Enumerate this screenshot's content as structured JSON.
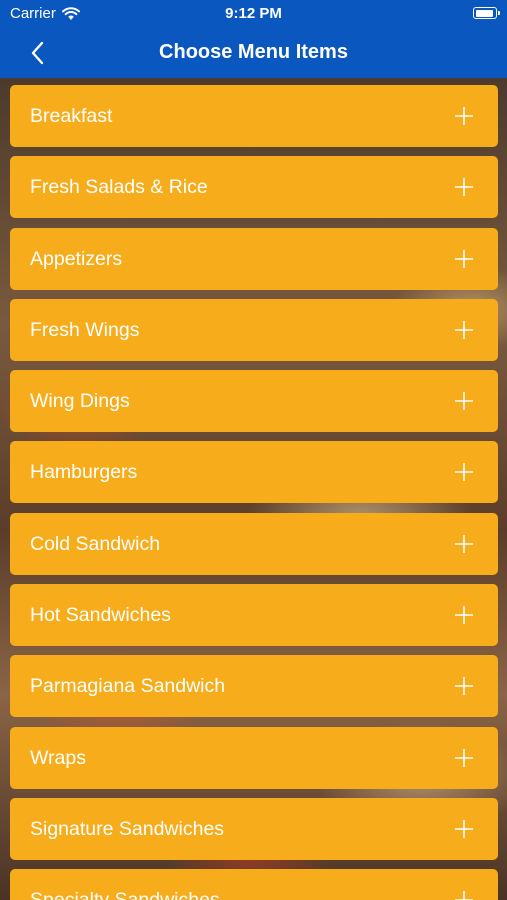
{
  "status_bar": {
    "carrier": "Carrier",
    "time": "9:12 PM",
    "battery_level": 0.95
  },
  "nav": {
    "back_icon": "chevron-left-icon",
    "title": "Choose Menu Items"
  },
  "colors": {
    "nav_background": "#0a57bf",
    "menu_row_background": "#f7ad1b",
    "text": "#ffffff"
  },
  "menu": {
    "row_icon": "plus-icon",
    "items": [
      {
        "label": "Breakfast"
      },
      {
        "label": "Fresh Salads & Rice"
      },
      {
        "label": "Appetizers"
      },
      {
        "label": "Fresh Wings"
      },
      {
        "label": "Wing Dings"
      },
      {
        "label": "Hamburgers"
      },
      {
        "label": "Cold Sandwich"
      },
      {
        "label": "Hot Sandwiches"
      },
      {
        "label": "Parmagiana Sandwich"
      },
      {
        "label": "Wraps"
      },
      {
        "label": "Signature Sandwiches"
      },
      {
        "label": "Specialty Sandwiches"
      }
    ]
  }
}
